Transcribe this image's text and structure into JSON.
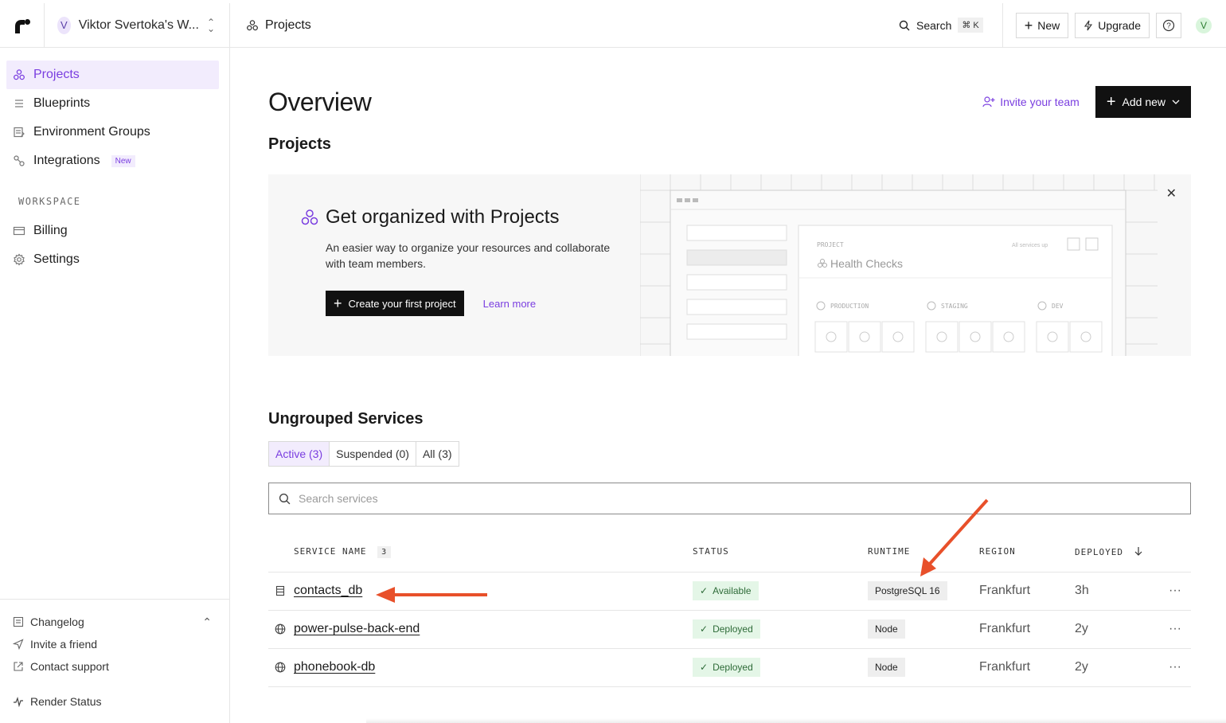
{
  "workspace": {
    "avatar_letter": "V",
    "name": "Viktor Svertoka's W..."
  },
  "sidebar": {
    "items": [
      {
        "label": "Projects",
        "icon": "projects-icon"
      },
      {
        "label": "Blueprints",
        "icon": "blueprints-icon"
      },
      {
        "label": "Environment Groups",
        "icon": "env-groups-icon"
      },
      {
        "label": "Integrations",
        "icon": "integrations-icon",
        "badge": "New"
      }
    ],
    "section_label": "WORKSPACE",
    "workspace_items": [
      {
        "label": "Billing",
        "icon": "billing-icon"
      },
      {
        "label": "Settings",
        "icon": "gear-icon"
      }
    ],
    "bottom": {
      "changelog": "Changelog",
      "invite": "Invite a friend",
      "support": "Contact support",
      "status": "Render Status"
    }
  },
  "topbar": {
    "title": "Projects",
    "search_label": "Search",
    "search_shortcut": "⌘ K",
    "new_label": "New",
    "upgrade_label": "Upgrade",
    "user_avatar": "V"
  },
  "main": {
    "title": "Overview",
    "invite_label": "Invite your team",
    "add_new_label": "Add new",
    "projects_heading": "Projects",
    "banner": {
      "title": "Get organized with Projects",
      "description": "An easier way to organize your resources and collaborate with team members.",
      "create_label": "Create your first project",
      "learn_more": "Learn more",
      "illus_project_label": "PROJECT",
      "illus_project_name": "Health Checks",
      "illus_all_up": "All services up",
      "illus_envs": [
        "PRODUCTION",
        "STAGING",
        "DEV"
      ]
    },
    "services_heading": "Ungrouped Services",
    "tabs": [
      "Active (3)",
      "Suspended (0)",
      "All (3)"
    ],
    "search_placeholder": "Search services",
    "table": {
      "headers": {
        "name": "SERVICE NAME",
        "count": "3",
        "status": "STATUS",
        "runtime": "RUNTIME",
        "region": "REGION",
        "deployed": "DEPLOYED"
      },
      "rows": [
        {
          "name": "contacts_db",
          "icon": "database-icon",
          "status": "Available",
          "runtime": "PostgreSQL 16",
          "region": "Frankfurt",
          "deployed": "3h",
          "more": "···"
        },
        {
          "name": "power-pulse-back-end",
          "icon": "globe-icon",
          "status": "Deployed",
          "runtime": "Node",
          "region": "Frankfurt",
          "deployed": "2y",
          "more": "···"
        },
        {
          "name": "phonebook-db",
          "icon": "globe-icon",
          "status": "Deployed",
          "runtime": "Node",
          "region": "Frankfurt",
          "deployed": "2y",
          "more": "···"
        }
      ]
    }
  },
  "colors": {
    "accent": "#7a3ee0",
    "annotation_arrow": "#e8502a",
    "status_bg": "#e4f6e7"
  }
}
